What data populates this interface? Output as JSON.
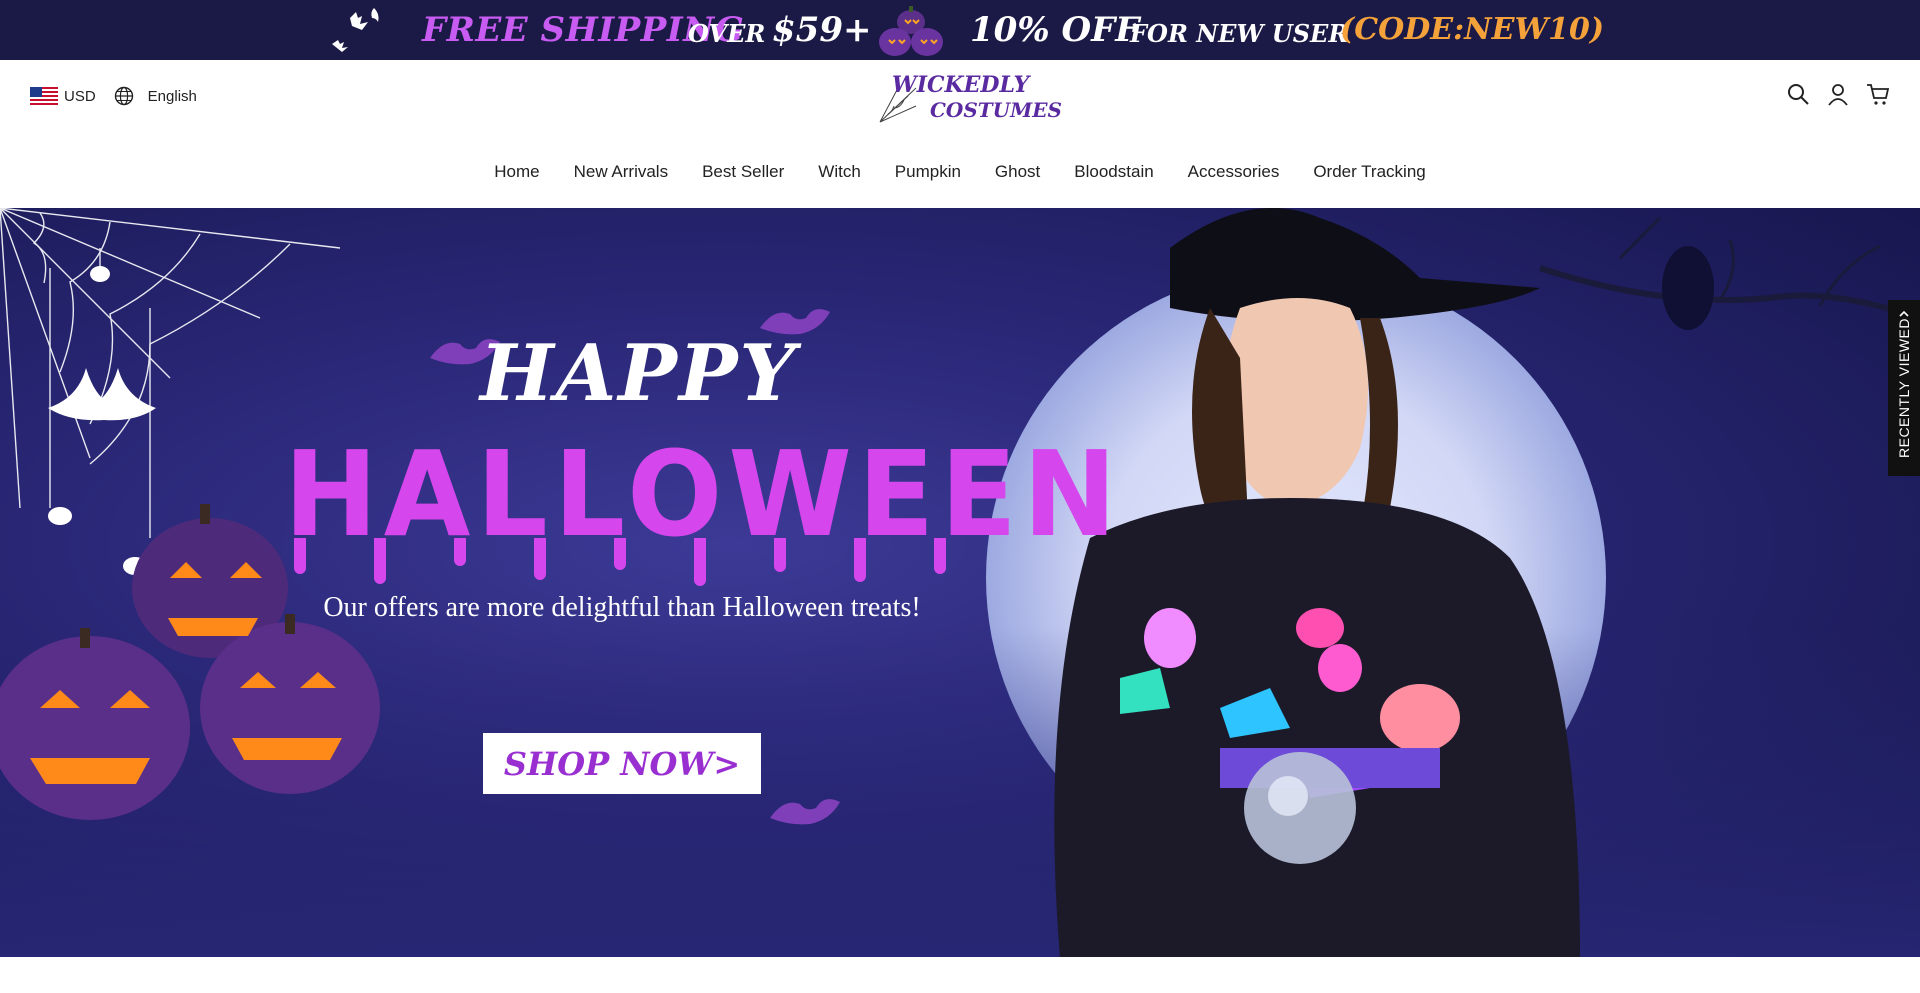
{
  "promo": {
    "free_shipping": "FREE SHIPPING",
    "over": "OVER",
    "amount": "$59+",
    "discount": "10% OFF",
    "for_new_user": "FOR NEW USER",
    "code": "(CODE:NEW10)"
  },
  "header": {
    "currency": "USD",
    "language": "English",
    "logo_line1": "WICKEDLY",
    "logo_line2": "COSTUMES"
  },
  "nav": {
    "items": [
      "Home",
      "New Arrivals",
      "Best Seller",
      "Witch",
      "Pumpkin",
      "Ghost",
      "Bloodstain",
      "Accessories",
      "Order Tracking"
    ]
  },
  "hero": {
    "happy": "HAPPY",
    "halloween": "HALLOWEEN",
    "tagline": "Our offers are more delightful than Halloween treats!",
    "cta": "SHOP NOW>"
  },
  "recently_viewed": "RECENTLY VIEWED",
  "colors": {
    "promo_bg": "#1b1a46",
    "accent_purple": "#d546ec",
    "accent_orange": "#f6a23a",
    "cta_text": "#9a2fd1"
  },
  "icons": [
    "bat-icon",
    "pumpkin-icon",
    "us-flag-icon",
    "globe-icon",
    "search-icon",
    "user-icon",
    "cart-icon",
    "chevron-up-icon"
  ]
}
